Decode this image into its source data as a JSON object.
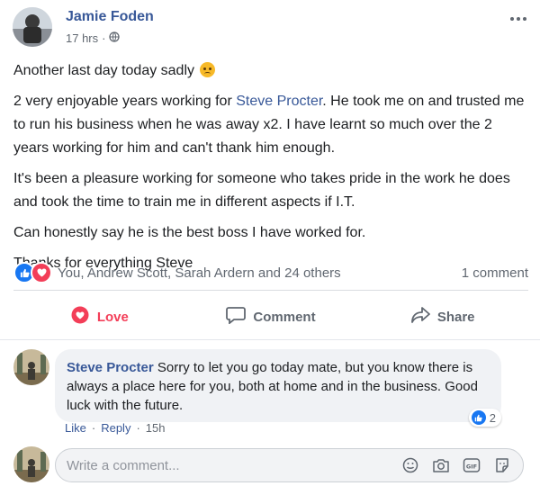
{
  "post": {
    "author": "Jamie Foden",
    "time": "17 hrs",
    "separator": "·",
    "more_icon": "more-horizontal-icon",
    "line1": "Another last day today sadly",
    "p2_before": "2 very enjoyable years working for ",
    "p2_link": "Steve Procter",
    "p2_after": ". He took me on and trusted me to run his business when he was away x2. I have learnt so much over the 2 years working for him and can't thank him enough.",
    "p3": "It's been a pleasure working for someone who takes pride in the work he does and took the time to train me in different aspects if I.T.",
    "p4": "Can honestly say he is the best boss I have worked for.",
    "p5": "Thanks for everything Steve"
  },
  "reactions": {
    "summary": "You, Andrew Scott, Sarah Ardern and 24 others",
    "comments": "1 comment"
  },
  "actions": {
    "love": "Love",
    "comment": "Comment",
    "share": "Share"
  },
  "comment": {
    "author": "Steve Procter",
    "text": "Sorry to let you go today mate, but you know there is always a place here for you, both at home and in the business. Good luck with the future.",
    "like_count": "2",
    "like_label": "Like",
    "reply_label": "Reply",
    "time": "15h",
    "dot": "·"
  },
  "compose": {
    "placeholder": "Write a comment..."
  },
  "colors": {
    "link": "#385898",
    "love": "#f33e58",
    "like": "#1877f2",
    "muted": "#606770"
  }
}
